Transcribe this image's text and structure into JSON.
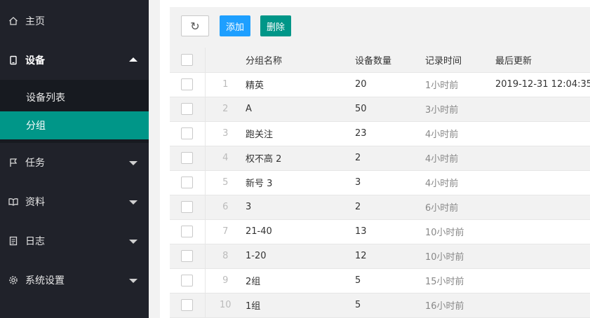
{
  "sidebar": {
    "items": [
      {
        "label": "主页",
        "icon": "home-icon"
      },
      {
        "label": "设备",
        "icon": "tablet-icon"
      },
      {
        "label": "任务",
        "icon": "flag-icon"
      },
      {
        "label": "资料",
        "icon": "book-icon"
      },
      {
        "label": "日志",
        "icon": "document-icon"
      },
      {
        "label": "系统设置",
        "icon": "gear-icon"
      }
    ],
    "sub_items": [
      {
        "label": "设备列表"
      },
      {
        "label": "分组"
      }
    ]
  },
  "toolbar": {
    "add_label": "添加",
    "delete_label": "删除",
    "refresh_glyph": "↻"
  },
  "table": {
    "headers": {
      "name": "分组名称",
      "count": "设备数量",
      "record_time": "记录时间",
      "last_update": "最后更新"
    },
    "rows": [
      {
        "index": "1",
        "name": "精英",
        "count": "20",
        "record_time": "1小时前",
        "last_update": "2019-12-31 12:04:35"
      },
      {
        "index": "2",
        "name": "A",
        "count": "50",
        "record_time": "3小时前",
        "last_update": ""
      },
      {
        "index": "3",
        "name": "跑关注",
        "count": "23",
        "record_time": "4小时前",
        "last_update": ""
      },
      {
        "index": "4",
        "name": "权不高 2",
        "count": "2",
        "record_time": "4小时前",
        "last_update": ""
      },
      {
        "index": "5",
        "name": "新号 3",
        "count": "3",
        "record_time": "4小时前",
        "last_update": ""
      },
      {
        "index": "6",
        "name": "3",
        "count": "2",
        "record_time": "6小时前",
        "last_update": ""
      },
      {
        "index": "7",
        "name": "21-40",
        "count": "13",
        "record_time": "10小时前",
        "last_update": ""
      },
      {
        "index": "8",
        "name": "1-20",
        "count": "12",
        "record_time": "10小时前",
        "last_update": ""
      },
      {
        "index": "9",
        "name": "2组",
        "count": "5",
        "record_time": "15小时前",
        "last_update": ""
      },
      {
        "index": "10",
        "name": "1组",
        "count": "5",
        "record_time": "16小时前",
        "last_update": ""
      }
    ]
  },
  "colors": {
    "sidebar_bg": "#20222a",
    "submenu_bg": "#171a20",
    "selected": "#009688",
    "add_button": "#1e9fff",
    "delete_button": "#009688"
  }
}
